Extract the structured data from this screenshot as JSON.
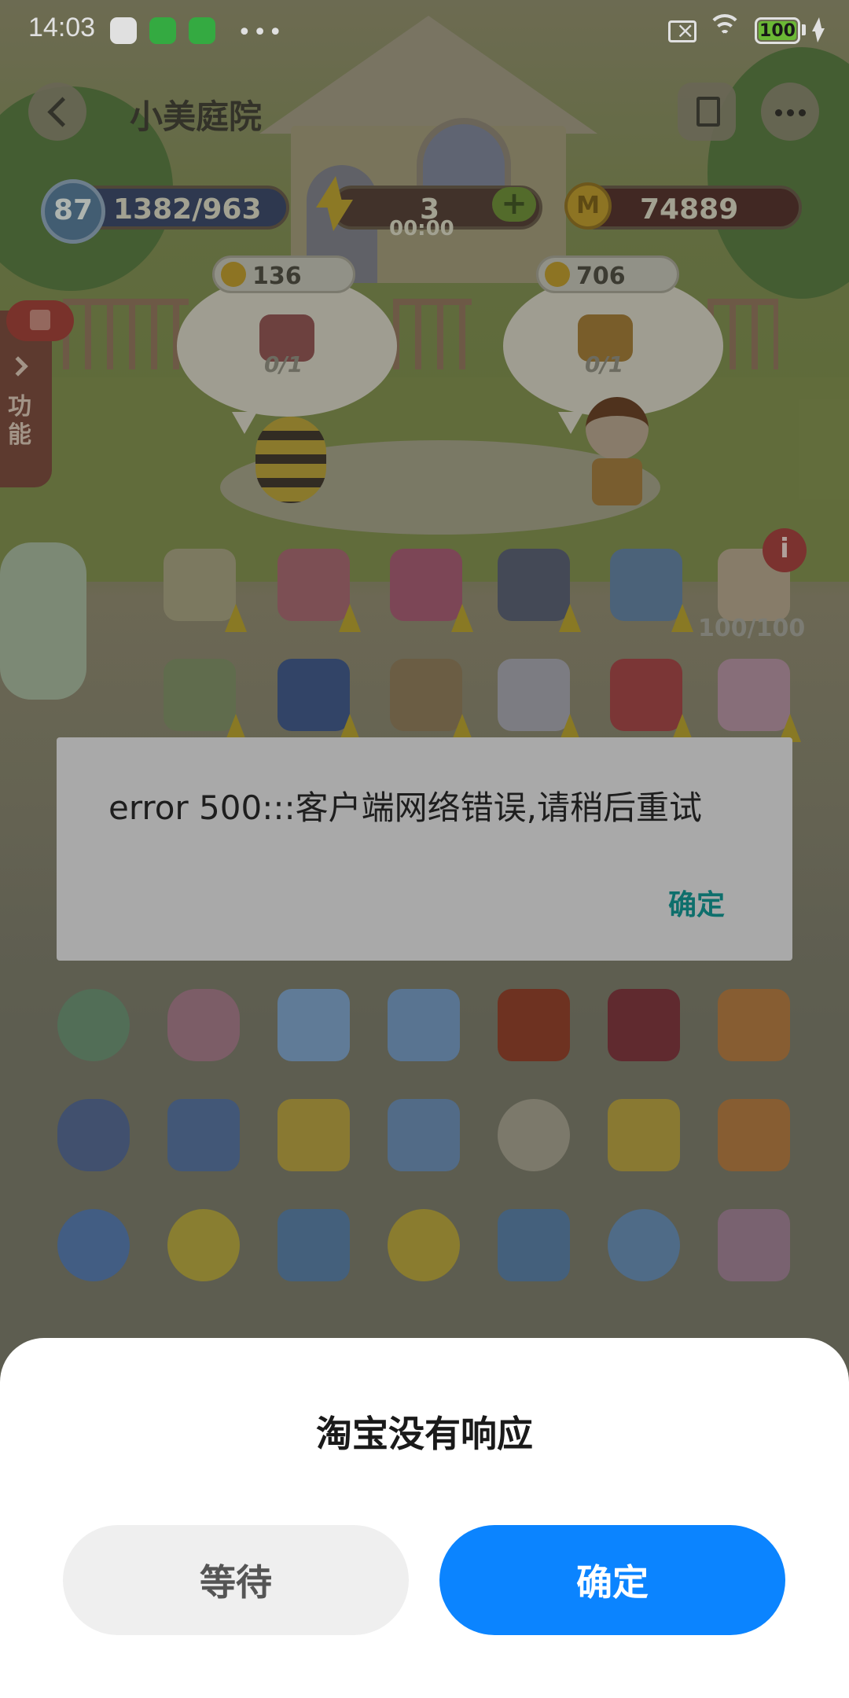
{
  "status_bar": {
    "time": "14:03",
    "battery": "100",
    "icons": [
      "play-store-icon",
      "app-green-icon",
      "app-green-icon",
      "more-dots-icon",
      "no-sim-icon",
      "wifi-icon",
      "battery-icon",
      "charging-icon"
    ]
  },
  "game": {
    "title": "小美庭院",
    "level": "87",
    "experience": "1382/963",
    "energy": "3",
    "energy_timer": "00:00",
    "coins": "74889",
    "orders": [
      {
        "price": "136",
        "progress": "0/1"
      },
      {
        "price": "706",
        "progress": "0/1"
      }
    ],
    "side_tab_label": "功能",
    "capacity": "100/100"
  },
  "error_dialog": {
    "message": "error 500:::客户端网络错误,请稍后重试",
    "ok_label": "确定",
    "accent_color": "#0e6f6c"
  },
  "anr_sheet": {
    "title": "淘宝没有响应",
    "wait_label": "等待",
    "ok_label": "确定",
    "primary_color": "#0b84ff"
  }
}
